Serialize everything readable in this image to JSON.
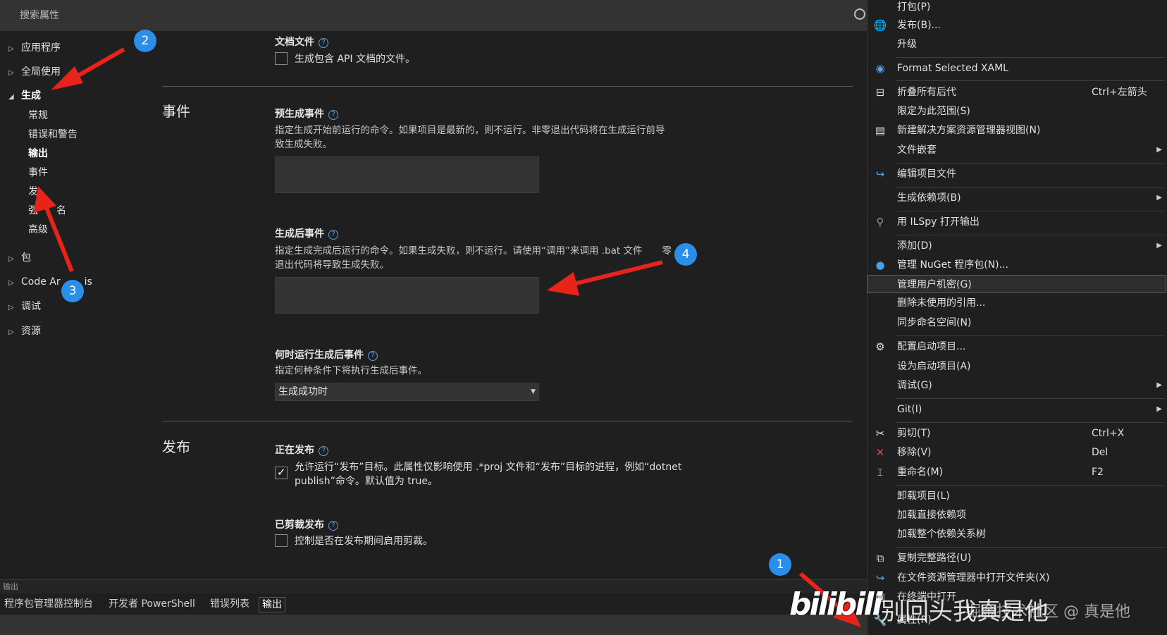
{
  "search": {
    "placeholder": "搜索属性"
  },
  "nav": {
    "items": [
      {
        "label": "应用程序",
        "expanded": false
      },
      {
        "label": "全局使用",
        "expanded": false
      },
      {
        "label": "生成",
        "expanded": true
      },
      {
        "label": "包",
        "expanded": false
      },
      {
        "label": "Code Ar",
        "label_tail": "is",
        "expanded": false
      },
      {
        "label": "调试",
        "expanded": false
      },
      {
        "label": "资源",
        "expanded": false
      }
    ],
    "build_children": [
      "常规",
      "错误和警告",
      "输出",
      "事件",
      "发",
      "强",
      "高级"
    ],
    "build_child_tails": {
      "強_tail": "名"
    }
  },
  "doc_file": {
    "title": "文档文件",
    "checkbox_label": "生成包含 API 文档的文件。",
    "checked": false
  },
  "events": {
    "section_title": "事件",
    "pre_build": {
      "title": "预生成事件",
      "desc_line1": "指定生成开始前运行的命令。如果项目是最新的，则不运行。非零退出代码将在生成运行前导",
      "desc_line2": "致生成失败。"
    },
    "post_build": {
      "title": "生成后事件",
      "desc_line1": "指定生成完成后运行的命令。如果生成失败，则不运行。请使用“调用”来调用 .bat 文件",
      "desc_line1_tail": "零",
      "desc_line2": "退出代码将导致生成失败。"
    },
    "run_when": {
      "title": "何时运行生成后事件",
      "desc": "指定何种条件下将执行生成后事件。",
      "selected": "生成成功时"
    }
  },
  "publish": {
    "section_title": "发布",
    "publishing": {
      "title": "正在发布",
      "checkbox_line1": "允许运行“发布”目标。此属性仅影响使用 .*proj 文件和“发布”目标的进程，例如“dotnet",
      "checkbox_line2": "publish”命令。默认值为 true。",
      "checked": true
    },
    "trimmed": {
      "title": "已剪裁发布",
      "checkbox_label": "控制是否在发布期间启用剪裁。",
      "checked": false
    }
  },
  "bottom": {
    "strip_label": "输出",
    "tabs": [
      "程序包管理器控制台",
      "开发者 PowerShell",
      "错误列表",
      "输出"
    ],
    "active_tab": 3
  },
  "menu": {
    "items": [
      {
        "label": "打包(P)",
        "icon": ""
      },
      {
        "label": "发布(B)...",
        "icon": "globe-icon"
      },
      {
        "label": "升级",
        "icon": ""
      },
      {
        "label": "Format Selected XAML",
        "icon": "xaml-icon"
      },
      {
        "label": "折叠所有后代",
        "shortcut": "Ctrl+左箭头",
        "icon": "collapse-icon"
      },
      {
        "label": "限定为此范围(S)",
        "icon": ""
      },
      {
        "label": "新建解决方案资源管理器视图(N)",
        "icon": "new-view-icon"
      },
      {
        "label": "文件嵌套",
        "submenu": true,
        "icon": ""
      },
      {
        "label": "编辑项目文件",
        "icon": "edit-arrow-icon"
      },
      {
        "label": "生成依赖项(B)",
        "submenu": true,
        "icon": ""
      },
      {
        "label": "用 ILSpy 打开输出",
        "icon": "ilspy-icon"
      },
      {
        "label": "添加(D)",
        "submenu": true,
        "icon": ""
      },
      {
        "label": "管理 NuGet 程序包(N)...",
        "icon": "nuget-icon"
      },
      {
        "label": "管理用户机密(G)",
        "icon": "",
        "highlighted": true
      },
      {
        "label": "删除未使用的引用...",
        "icon": ""
      },
      {
        "label": "同步命名空间(N)",
        "icon": ""
      },
      {
        "label": "配置启动项目...",
        "icon": "gear-icon"
      },
      {
        "label": "设为启动项目(A)",
        "icon": ""
      },
      {
        "label": "调试(G)",
        "submenu": true,
        "icon": ""
      },
      {
        "label": "Git(I)",
        "submenu": true,
        "icon": ""
      },
      {
        "label": "剪切(T)",
        "shortcut": "Ctrl+X",
        "icon": "scissors-icon"
      },
      {
        "label": "移除(V)",
        "shortcut": "Del",
        "icon": "remove-x-icon"
      },
      {
        "label": "重命名(M)",
        "shortcut": "F2",
        "icon": "rename-icon"
      },
      {
        "label": "卸载项目(L)",
        "icon": ""
      },
      {
        "label": "加载直接依赖项",
        "icon": ""
      },
      {
        "label": "加载整个依赖关系树",
        "icon": ""
      },
      {
        "label": "复制完整路径(U)",
        "icon": "copy-icon"
      },
      {
        "label": "在文件资源管理器中打开文件夹(X)",
        "icon": "open-folder-arrow-icon"
      },
      {
        "label": "在终端中打开",
        "icon": "terminal-icon"
      },
      {
        "label": "属性(R)",
        "icon": "wrench-icon"
      }
    ]
  },
  "annotations": {
    "badges": [
      "1",
      "2",
      "3",
      "4"
    ]
  },
  "watermark": {
    "logo": "bilibili",
    "text": "别回头我真是他",
    "sub": "掘金技术社区 @ 真是他"
  },
  "colors": {
    "background": "#1f1f1f",
    "panel": "#333333",
    "badge": "#2b8ee8",
    "arrow": "#e8231a",
    "accent": "#5aa0e0"
  }
}
